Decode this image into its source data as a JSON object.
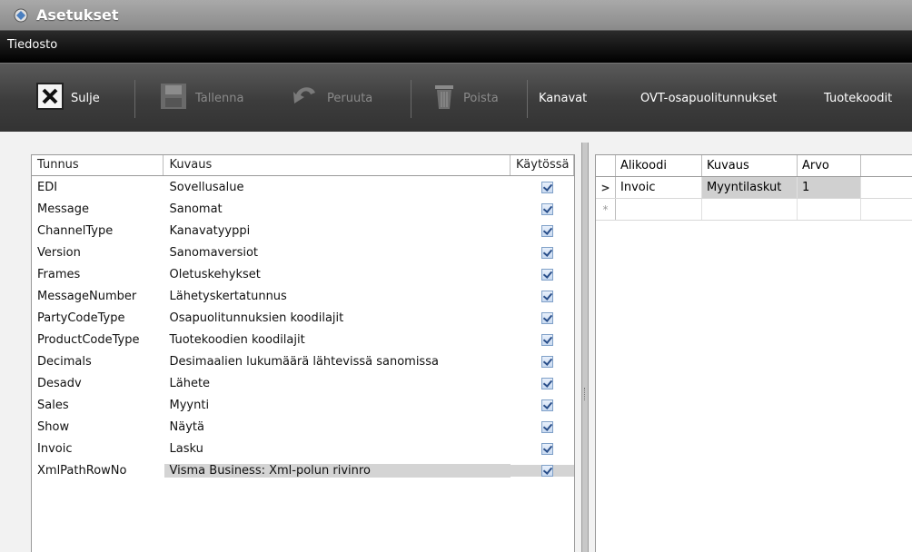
{
  "window": {
    "title": "Asetukset"
  },
  "menu": {
    "file_label": "Tiedosto"
  },
  "toolbar": {
    "close_label": "Sulje",
    "save_label": "Tallenna",
    "undo_label": "Peruuta",
    "delete_label": "Poista",
    "channels_label": "Kanavat",
    "ovt_label": "OVT-osapuolitunnukset",
    "product_codes_label": "Tuotekoodit"
  },
  "left_grid": {
    "headers": [
      "Tunnus",
      "Kuvaus",
      "Käytössä"
    ],
    "rows": [
      {
        "code": "EDI",
        "description": "Sovellusalue",
        "enabled": true
      },
      {
        "code": "Message",
        "description": "Sanomat",
        "enabled": true
      },
      {
        "code": "ChannelType",
        "description": "Kanavatyyppi",
        "enabled": true
      },
      {
        "code": "Version",
        "description": "Sanomaversiot",
        "enabled": true
      },
      {
        "code": "Frames",
        "description": "Oletuskehykset",
        "enabled": true
      },
      {
        "code": "MessageNumber",
        "description": "Lähetyskertatunnus",
        "enabled": true
      },
      {
        "code": "PartyCodeType",
        "description": "Osapuolitunnuksien koodilajit",
        "enabled": true
      },
      {
        "code": "ProductCodeType",
        "description": "Tuotekoodien koodilajit",
        "enabled": true
      },
      {
        "code": "Decimals",
        "description": "Desimaalien lukumäärä lähtevissä sanomissa",
        "enabled": true
      },
      {
        "code": "Desadv",
        "description": "Lähete",
        "enabled": true
      },
      {
        "code": "Sales",
        "description": "Myynti",
        "enabled": true
      },
      {
        "code": "Show",
        "description": "Näytä",
        "enabled": true
      },
      {
        "code": "Invoic",
        "description": "Lasku",
        "enabled": true
      },
      {
        "code": "XmlPathRowNo",
        "description": "Visma Business: Xml-polun rivinro",
        "enabled": true
      }
    ]
  },
  "right_grid": {
    "headers": [
      "Alikoodi",
      "Kuvaus",
      "Arvo"
    ],
    "rows": [
      {
        "subcode": "Invoic",
        "description": "Myyntilaskut",
        "value": "1"
      }
    ],
    "current_row_marker": ">",
    "new_row_marker": "*"
  },
  "colors": {
    "titlebar": "#999999",
    "menubar": "#111111",
    "toolbar": "#444444",
    "selection": "#d4d4d4"
  }
}
